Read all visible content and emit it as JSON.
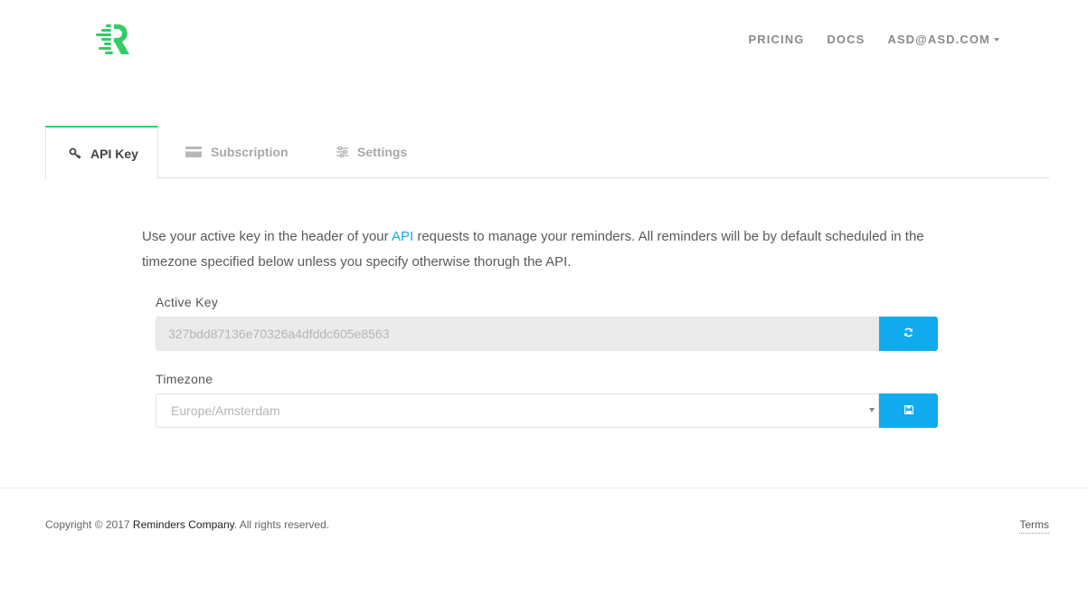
{
  "colors": {
    "accent": "#33cc66",
    "primary": "#11aaee",
    "link": "#1ca8e0"
  },
  "header": {
    "logo_icon": "reminders-logo-icon",
    "nav": {
      "pricing": "PRICING",
      "docs": "DOCS",
      "account": "ASD@ASD.COM"
    }
  },
  "tabs": [
    {
      "label": "API Key",
      "icon": "key-icon",
      "active": true
    },
    {
      "label": "Subscription",
      "icon": "credit-card-icon",
      "active": false
    },
    {
      "label": "Settings",
      "icon": "sliders-icon",
      "active": false
    }
  ],
  "intro": {
    "before": "Use your active key in the header of your ",
    "link": "API",
    "after": " requests to manage your reminders. All reminders will be by default scheduled in the timezone specified below unless you specify otherwise thorugh the API."
  },
  "active_key": {
    "label": "Active Key",
    "value": "327bdd87136e70326a4dfddc605e8563",
    "button_icon": "refresh-icon"
  },
  "timezone": {
    "label": "Timezone",
    "selected": "Europe/Amsterdam",
    "button_icon": "save-icon"
  },
  "footer": {
    "copyright_prefix": "Copyright © 2017 ",
    "company": "Reminders Company",
    "copyright_suffix": ". All rights reserved.",
    "terms": "Terms"
  }
}
